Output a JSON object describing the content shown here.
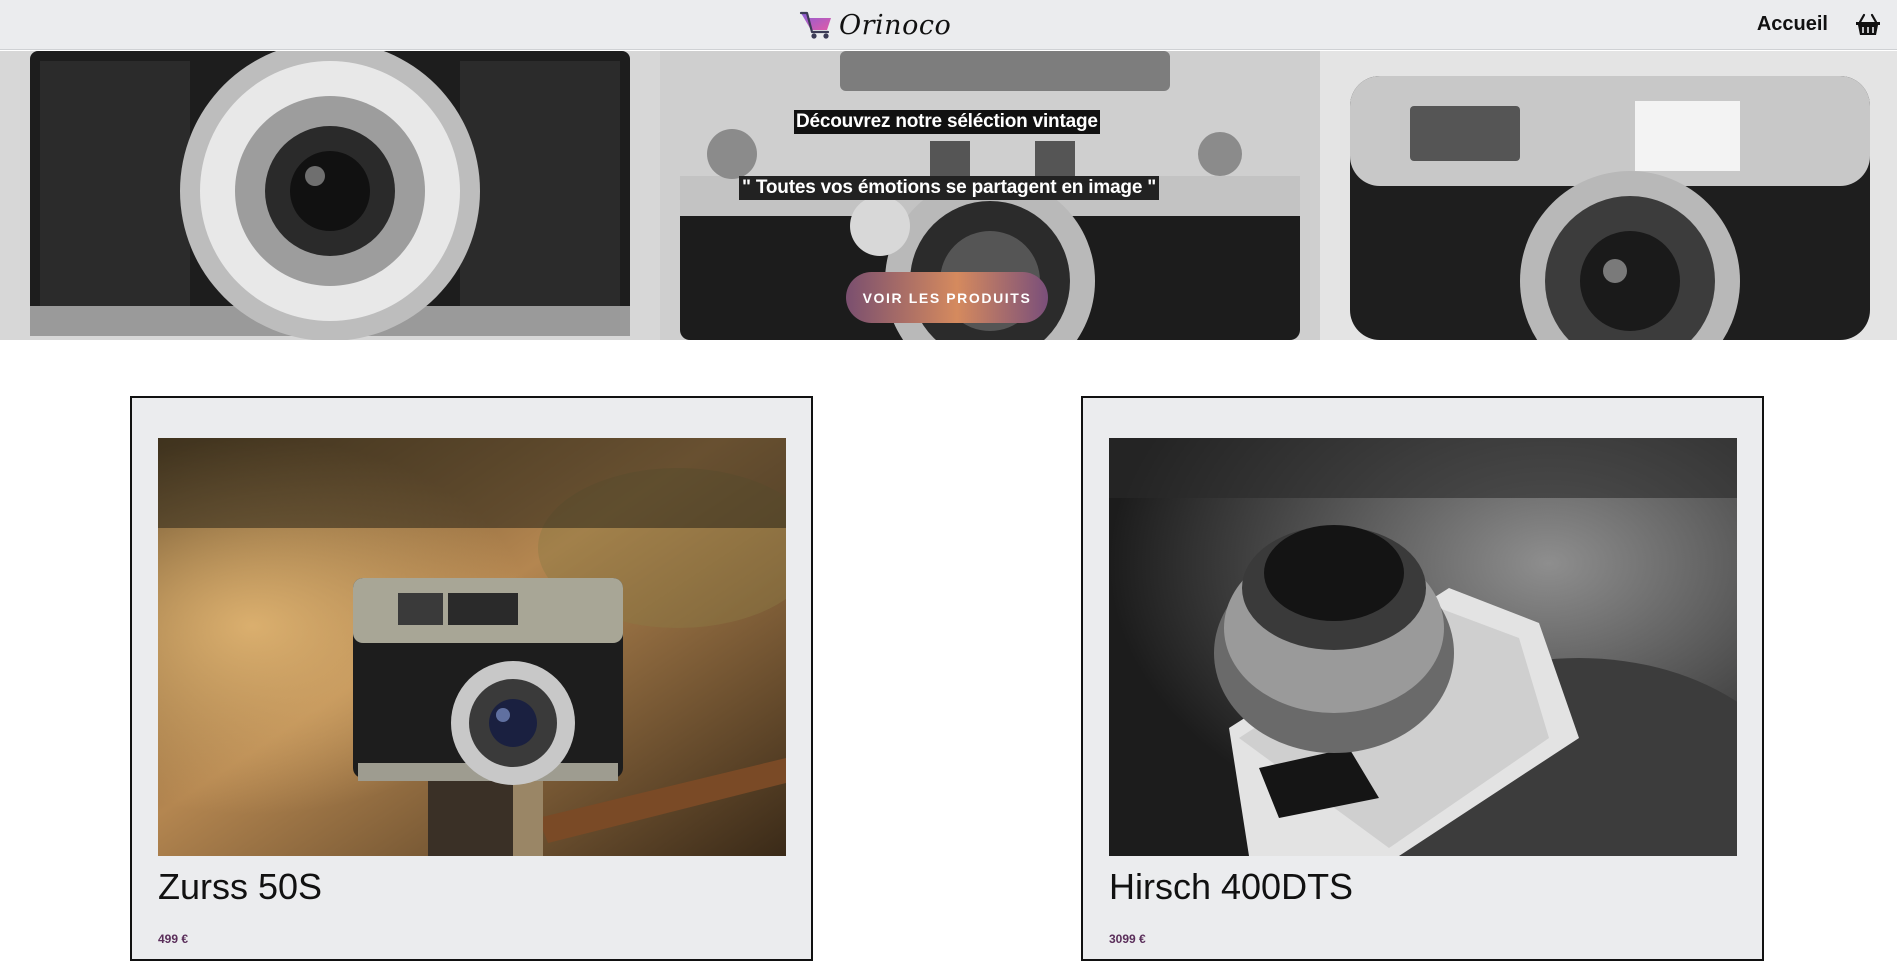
{
  "navbar": {
    "brand_name": "Orinoco",
    "home_label": "Accueil"
  },
  "hero": {
    "title": "Découvrez notre séléction vintage",
    "quote": "\" Toutes vos émotions se partagent en image \"",
    "cta_label": "VOIR LES PRODUITS"
  },
  "products": [
    {
      "name": "Zurss 50S",
      "price": "499 €"
    },
    {
      "name": "Hirsch 400DTS",
      "price": "3099 €"
    }
  ],
  "colors": {
    "nav_bg": "#ebecee",
    "card_bg": "#ebecee",
    "price": "#5a2e5a",
    "cta_start": "#7a4f6f",
    "cta_mid": "#d58a5e"
  },
  "icons": {
    "brand": "shopping-cart-icon",
    "cart": "basket-icon"
  }
}
